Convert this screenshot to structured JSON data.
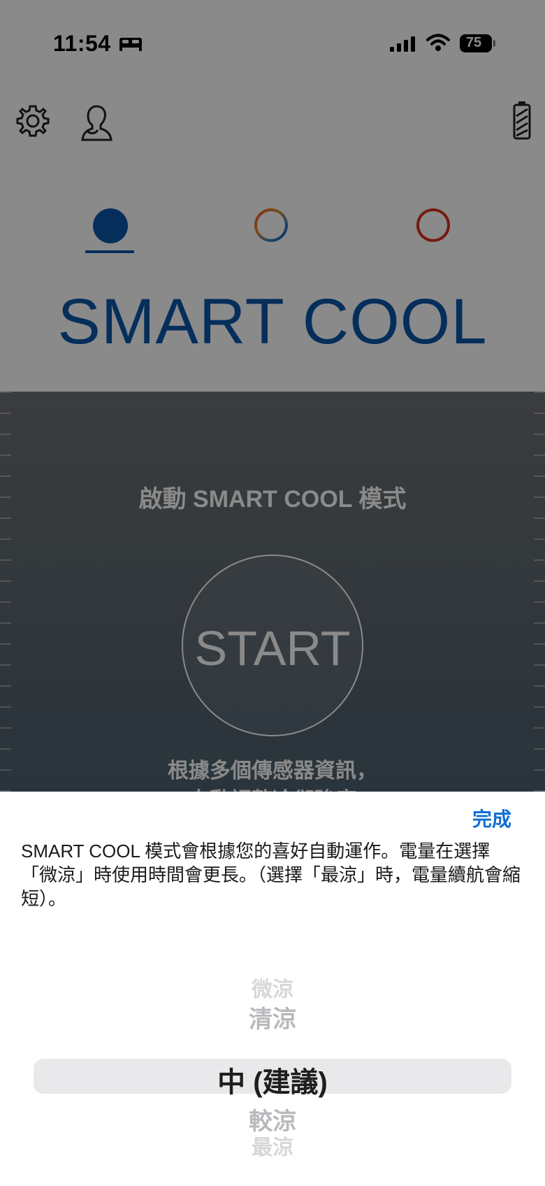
{
  "status_bar": {
    "time": "11:54",
    "battery_level": "75"
  },
  "mode": {
    "title": "SMART COOL"
  },
  "main": {
    "heading": "啟動 SMART COOL 模式",
    "start_label": "START",
    "description_line1": "根據多個傳感器資訊，",
    "description_line2": "自動調整冷卻強度"
  },
  "sheet": {
    "done_label": "完成",
    "description": "SMART COOL 模式會根據您的喜好自動運作。電量在選擇「微涼」時使用時間會更長。（選擇「最涼」時，電量續航會縮短）。",
    "picker_options": [
      "微涼",
      "清涼",
      "中 (建議)",
      "較涼",
      "最涼"
    ],
    "selected_option": "中 (建議)"
  },
  "colors": {
    "accent": "#0b56a8",
    "link": "#0f6fd3",
    "max_mode": "#d7301f"
  }
}
